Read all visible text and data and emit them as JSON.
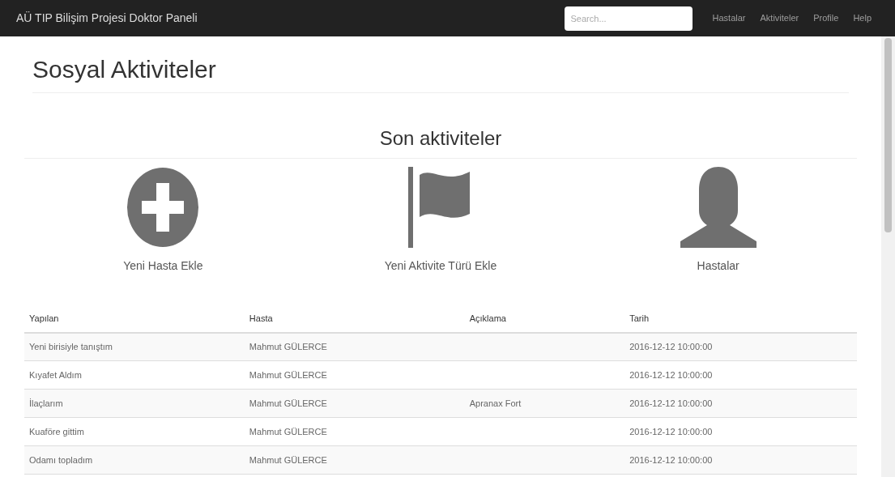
{
  "navbar": {
    "brand": "AÜ TIP Bilişim Projesi Doktor Paneli",
    "search": {
      "placeholder": "Search..."
    },
    "links": [
      "Hastalar",
      "Aktiviteler",
      "Profile",
      "Help"
    ]
  },
  "page_title": "Sosyal Aktiviteler",
  "section_title": "Son aktiviteler",
  "shortcuts": [
    {
      "kind": "plus",
      "label": "Yeni Hasta Ekle"
    },
    {
      "kind": "flag",
      "label": "Yeni Aktivite Türü Ekle"
    },
    {
      "kind": "user",
      "label": "Hastalar"
    }
  ],
  "table": {
    "columns": [
      "Yapılan",
      "Hasta",
      "Açıklama",
      "Tarih"
    ],
    "rows": [
      [
        "Yeni birisiyle tanıştım",
        "Mahmut GÜLERCE",
        "",
        "2016-12-12 10:00:00"
      ],
      [
        "Kıyafet Aldım",
        "Mahmut GÜLERCE",
        "",
        "2016-12-12 10:00:00"
      ],
      [
        "İlaçlarım",
        "Mahmut GÜLERCE",
        "Apranax Fort",
        "2016-12-12 10:00:00"
      ],
      [
        "Kuaföre gittim",
        "Mahmut GÜLERCE",
        "",
        "2016-12-12 10:00:00"
      ],
      [
        "Odamı topladım",
        "Mahmut GÜLERCE",
        "",
        "2016-12-12 10:00:00"
      ]
    ]
  }
}
